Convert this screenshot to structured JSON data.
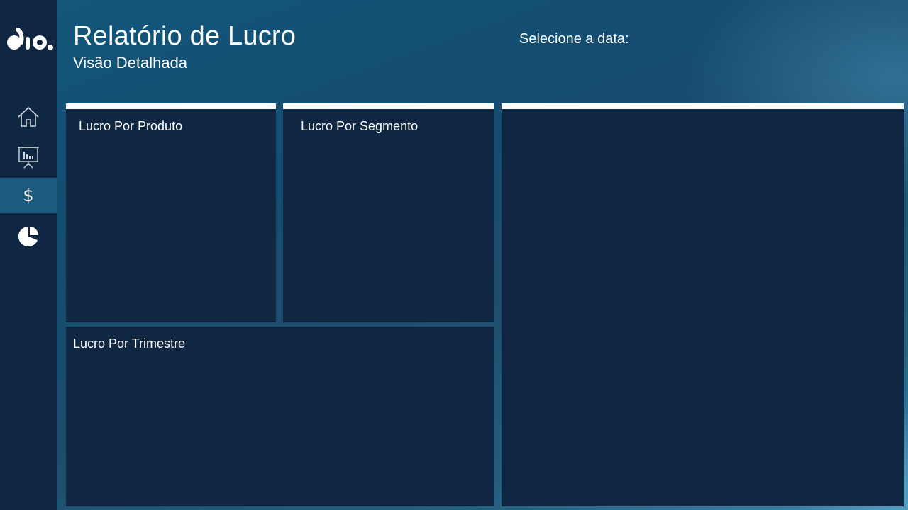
{
  "header": {
    "title": "Relatório de Lucro",
    "subtitle": "Visão Detalhada",
    "date_label": "Selecione a data:"
  },
  "sidebar": {
    "logo_text": "dio.",
    "items": [
      {
        "icon": "home-icon",
        "active": false
      },
      {
        "icon": "presentation-chart-icon",
        "active": false
      },
      {
        "icon": "dollar-icon",
        "label": "$",
        "active": true
      },
      {
        "icon": "pie-chart-icon",
        "active": false
      }
    ]
  },
  "panels": {
    "produto": {
      "title": "Lucro Por Produto"
    },
    "segmento": {
      "title": "Lucro Por Segmento"
    },
    "trimestre": {
      "title": "Lucro Por Trimestre"
    }
  },
  "colors": {
    "sidebar_bg": "#0f2742",
    "panel_bg": "#0f2742",
    "active_nav": "#1c5a80",
    "accent_border": "#ffffff"
  }
}
